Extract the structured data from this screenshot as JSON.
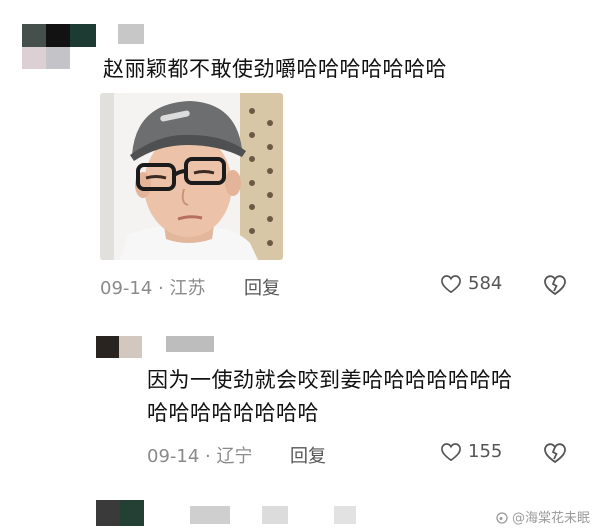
{
  "comment1": {
    "text": "赵丽颖都不敢使劲嚼哈哈哈哈哈哈哈",
    "date": "09-14",
    "location": "江苏",
    "reply_label": "回复",
    "likes": "584",
    "avatar_colors": [
      "#45504c",
      "#141414",
      "#1d3b33",
      "#d8c9cd",
      "#c4c3c8"
    ]
  },
  "comment2": {
    "text_line1": "因为一使劲就会咬到姜哈哈哈哈哈哈哈",
    "text_line2": "哈哈哈哈哈哈哈哈",
    "date": "09-14",
    "location": "辽宁",
    "reply_label": "回复",
    "likes": "155"
  },
  "watermark": {
    "text": "@海棠花未眠"
  },
  "colors": {
    "text": "#111111",
    "meta": "#8a8a8a",
    "icon": "#555555",
    "background": "#ffffff"
  }
}
